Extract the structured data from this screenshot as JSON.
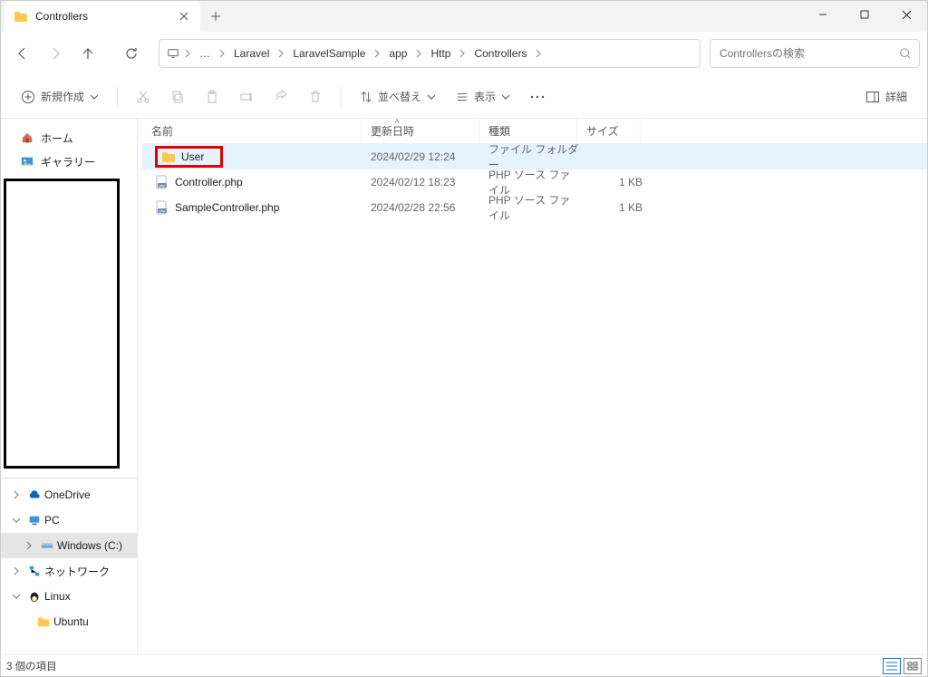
{
  "titlebar": {
    "tab_title": "Controllers"
  },
  "breadcrumbs": [
    "Laravel",
    "LaravelSample",
    "app",
    "Http",
    "Controllers"
  ],
  "search": {
    "placeholder": "Controllersの検索"
  },
  "toolbar": {
    "new_label": "新規作成",
    "sort_label": "並べ替え",
    "view_label": "表示",
    "details_label": "詳細"
  },
  "sidebar": {
    "home": "ホーム",
    "gallery": "ギャラリー",
    "onedrive": "OneDrive",
    "pc": "PC",
    "windows_c": "Windows (C:)",
    "network": "ネットワーク",
    "linux": "Linux",
    "ubuntu": "Ubuntu"
  },
  "columns": {
    "name": "名前",
    "date": "更新日時",
    "type": "種類",
    "size": "サイズ"
  },
  "rows": [
    {
      "name": "User",
      "date": "2024/02/29 12:24",
      "type": "ファイル フォルダー",
      "size": "",
      "icon": "folder",
      "highlighted": true
    },
    {
      "name": "Controller.php",
      "date": "2024/02/12 18:23",
      "type": "PHP ソース ファイル",
      "size": "1 KB",
      "icon": "php",
      "highlighted": false
    },
    {
      "name": "SampleController.php",
      "date": "2024/02/28 22:56",
      "type": "PHP ソース ファイル",
      "size": "1 KB",
      "icon": "php",
      "highlighted": false
    }
  ],
  "status": {
    "text": "3 個の項目"
  }
}
